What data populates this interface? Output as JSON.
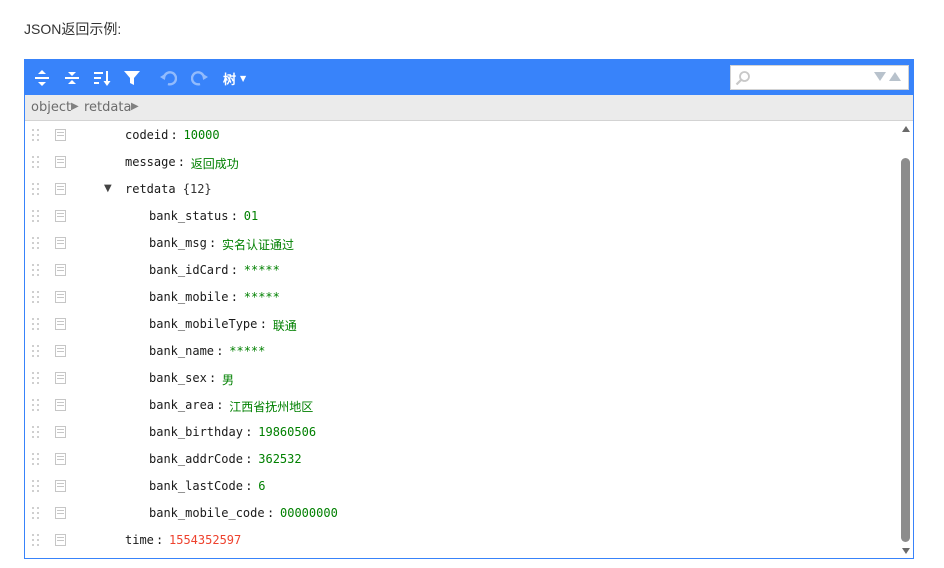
{
  "heading": "JSON返回示例:",
  "toolbar": {
    "mode_label": "树",
    "buttons": [
      {
        "name": "expand-all-button",
        "icon": "expand-all-icon"
      },
      {
        "name": "collapse-all-button",
        "icon": "collapse-all-icon"
      },
      {
        "name": "sort-button",
        "icon": "sort-icon"
      },
      {
        "name": "filter-button",
        "icon": "filter-icon"
      },
      {
        "name": "undo-button",
        "icon": "undo-icon",
        "disabled": true
      },
      {
        "name": "redo-button",
        "icon": "redo-icon",
        "disabled": true
      }
    ]
  },
  "search": {
    "placeholder": "",
    "value": ""
  },
  "breadcrumb": [
    "object",
    "retdata"
  ],
  "tree": [
    {
      "key": "codeid",
      "value": "10000",
      "type": "string",
      "depth": 0
    },
    {
      "key": "message",
      "value": "返回成功",
      "type": "string",
      "depth": 0
    },
    {
      "key": "retdata",
      "count": "{12}",
      "type": "object",
      "depth": 0,
      "expanded": true
    },
    {
      "key": "bank_status",
      "value": "01",
      "type": "string",
      "depth": 1
    },
    {
      "key": "bank_msg",
      "value": "实名认证通过",
      "type": "string",
      "depth": 1
    },
    {
      "key": "bank_idCard",
      "value": "*****",
      "type": "string",
      "depth": 1
    },
    {
      "key": "bank_mobile",
      "value": "*****",
      "type": "string",
      "depth": 1
    },
    {
      "key": "bank_mobileType",
      "value": "联通",
      "type": "string",
      "depth": 1
    },
    {
      "key": "bank_name",
      "value": "*****",
      "type": "string",
      "depth": 1
    },
    {
      "key": "bank_sex",
      "value": "男",
      "type": "string",
      "depth": 1
    },
    {
      "key": "bank_area",
      "value": "江西省抚州地区",
      "type": "string",
      "depth": 1
    },
    {
      "key": "bank_birthday",
      "value": "19860506",
      "type": "string",
      "depth": 1
    },
    {
      "key": "bank_addrCode",
      "value": "362532",
      "type": "string",
      "depth": 1
    },
    {
      "key": "bank_lastCode",
      "value": "6",
      "type": "string",
      "depth": 1
    },
    {
      "key": "bank_mobile_code",
      "value": "00000000",
      "type": "string",
      "depth": 1
    },
    {
      "key": "time",
      "value": "1554352597",
      "type": "number",
      "depth": 0
    }
  ],
  "colors": {
    "accent": "#3883fa",
    "string_value": "#008000",
    "number_value": "#ee422e",
    "nav_bg": "#ebebeb"
  }
}
